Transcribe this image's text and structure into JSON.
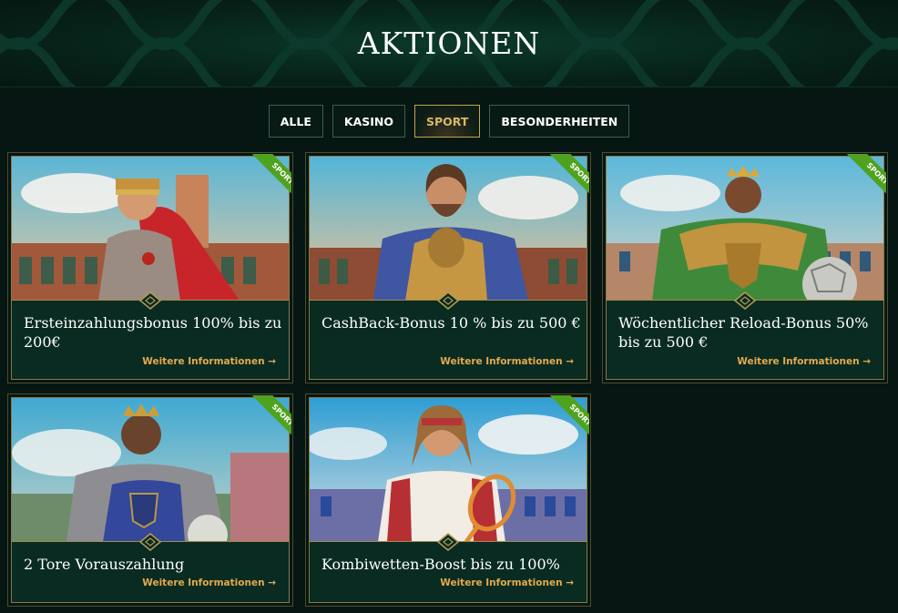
{
  "header": {
    "title": "AKTIONEN"
  },
  "tabs": [
    {
      "label": "ALLE",
      "active": false
    },
    {
      "label": "KASINO",
      "active": false
    },
    {
      "label": "SPORT",
      "active": true
    },
    {
      "label": "BESONDERHEITEN",
      "active": false
    }
  ],
  "promotions": [
    {
      "badge": "SPORT",
      "title": "Ersteinzahlungsbonus 100% bis zu 200€",
      "link": "Weitere Informationen →",
      "image": "gladiator-red-cape-art"
    },
    {
      "badge": "SPORT",
      "title": "CashBack-Bonus 10 % bis zu 500 €",
      "link": "Weitere Informationen →",
      "image": "bearded-warrior-blue-armor-art"
    },
    {
      "badge": "SPORT",
      "title": "Wöchentlicher Reload-Bonus 50% bis zu 500 €",
      "link": "Weitere Informationen →",
      "image": "crowned-warrior-gold-armor-football-art"
    },
    {
      "badge": "SPORT",
      "title": "2 Tore Vorauszahlung",
      "link": "Weitere Informationen →",
      "image": "crowned-warrior-blue-tunic-art"
    },
    {
      "badge": "SPORT",
      "title": "Kombiwetten-Boost bis zu 100%",
      "link": "Weitere Informationen →",
      "image": "tennis-player-headband-art"
    }
  ],
  "colors": {
    "background": "#061612",
    "card": "#092b21",
    "accent_gold": "#c5a250",
    "link": "#e3a94e",
    "badge_green": "#4fa21e"
  }
}
